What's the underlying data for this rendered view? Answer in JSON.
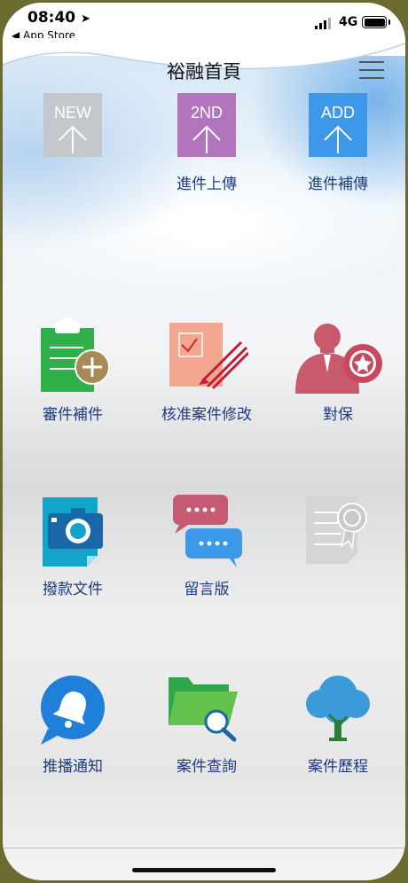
{
  "status": {
    "time": "08:40",
    "back_label": "App Store",
    "network": "4G"
  },
  "header": {
    "title": "裕融首頁"
  },
  "tiles": [
    {
      "label": "",
      "icon": "upload-new-icon",
      "badge": "NEW"
    },
    {
      "label": "進件上傳",
      "icon": "upload-2nd-icon",
      "badge": "2ND"
    },
    {
      "label": "進件補傳",
      "icon": "upload-add-icon",
      "badge": "ADD"
    },
    {
      "label": "審件補件",
      "icon": "clipboard-add-icon"
    },
    {
      "label": "核准案件修改",
      "icon": "edit-document-icon"
    },
    {
      "label": "對保",
      "icon": "person-badge-icon"
    },
    {
      "label": "撥款文件",
      "icon": "camera-document-icon"
    },
    {
      "label": "留言版",
      "icon": "chat-bubbles-icon"
    },
    {
      "label": "",
      "icon": "certificate-icon"
    },
    {
      "label": "推播通知",
      "icon": "bell-icon"
    },
    {
      "label": "案件查詢",
      "icon": "folder-search-icon"
    },
    {
      "label": "案件歷程",
      "icon": "tree-icon"
    }
  ]
}
